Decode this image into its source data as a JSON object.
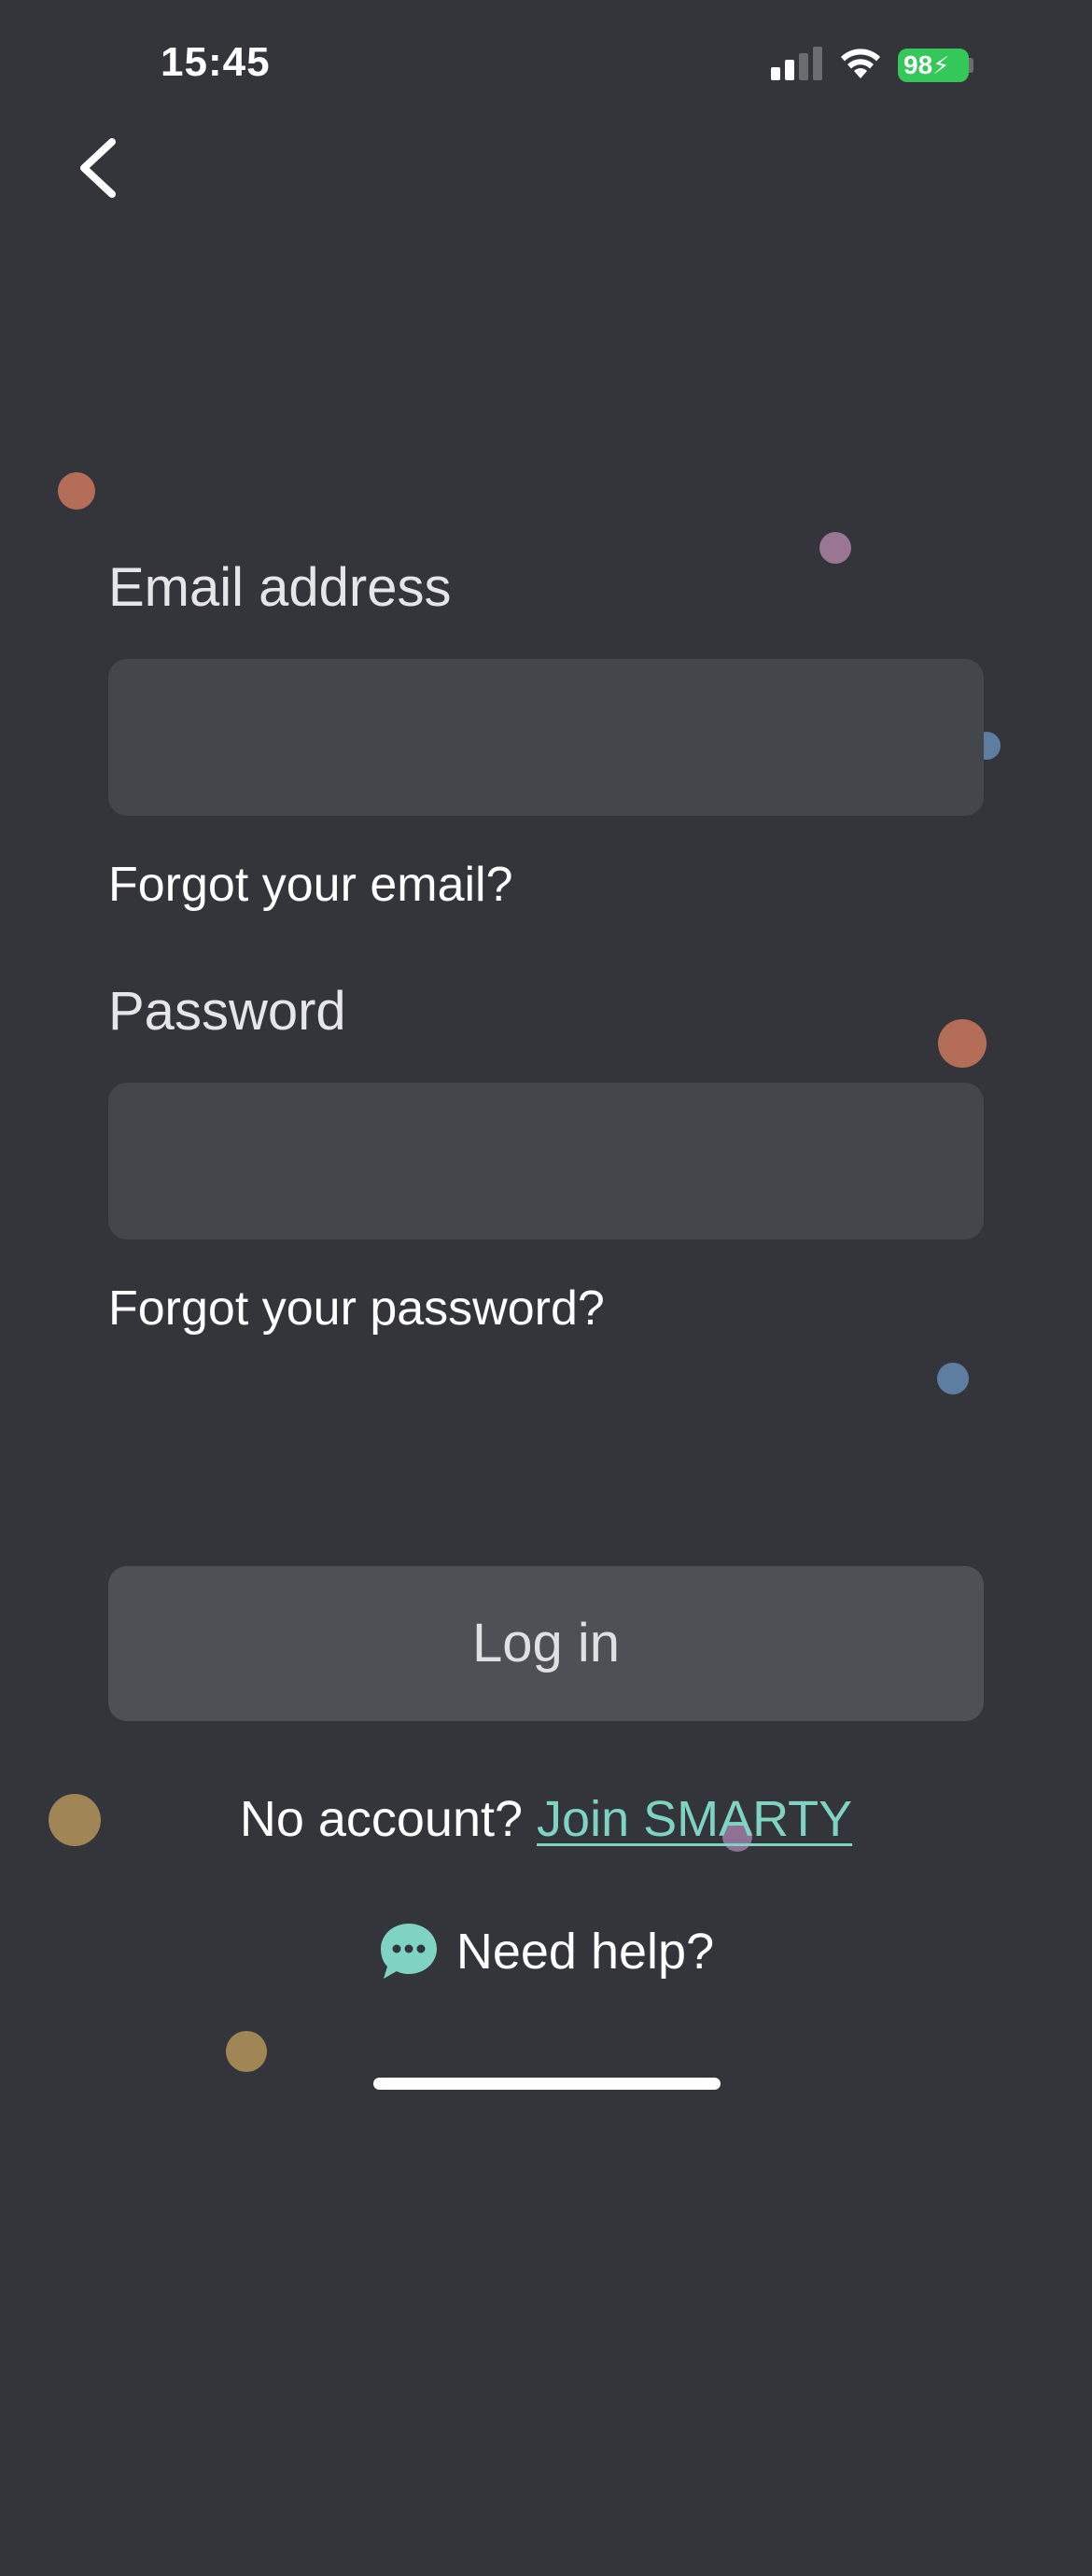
{
  "status_bar": {
    "time": "15:45",
    "battery": "98"
  },
  "form": {
    "email_label": "Email address",
    "email_value": "",
    "forgot_email": "Forgot your email?",
    "password_label": "Password",
    "password_value": "",
    "forgot_password": "Forgot your password?",
    "login_label": "Log in"
  },
  "signup": {
    "prompt": "No account?",
    "link": "Join SMARTY"
  },
  "help": {
    "label": "Need help?"
  },
  "icons": {
    "back": "chevron-left-icon",
    "help": "chat-bubble-icon",
    "signal": "cellular-signal-icon",
    "wifi": "wifi-icon",
    "battery": "battery-charging-icon"
  },
  "colors": {
    "background": "#34353a",
    "field": "#43464b",
    "button": "#4f5055",
    "accent": "#7fd3c2",
    "battery": "#34c759"
  }
}
